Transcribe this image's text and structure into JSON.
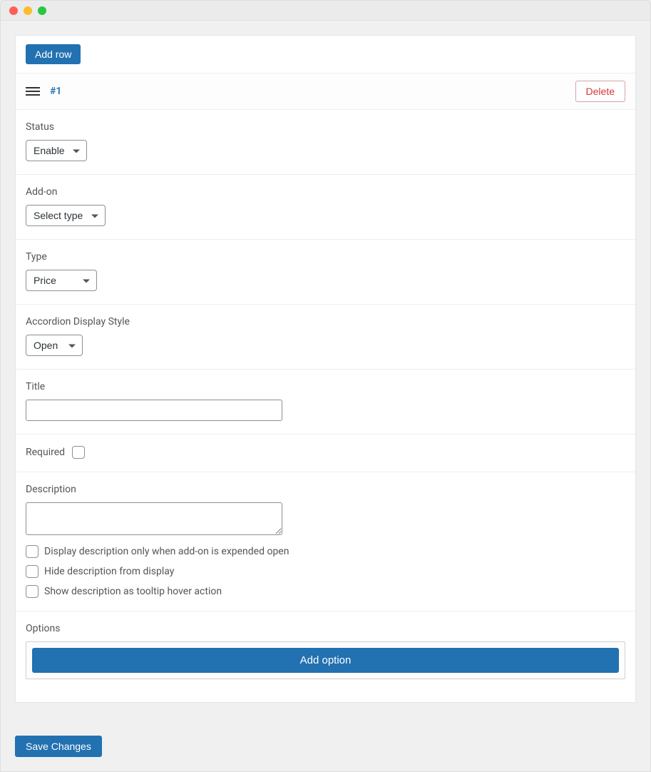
{
  "header": {
    "add_row_label": "Add row"
  },
  "row": {
    "label": "#1",
    "delete_label": "Delete"
  },
  "fields": {
    "status": {
      "label": "Status",
      "value": "Enable"
    },
    "addon": {
      "label": "Add-on",
      "value": "Select type"
    },
    "type": {
      "label": "Type",
      "value": "Price"
    },
    "accordion": {
      "label": "Accordion Display Style",
      "value": "Open"
    },
    "title": {
      "label": "Title",
      "value": ""
    },
    "required": {
      "label": "Required"
    },
    "description": {
      "label": "Description",
      "value": ""
    },
    "desc_opts": {
      "expanded": "Display description only when add-on is expended open",
      "hide": "Hide description from display",
      "tooltip": "Show description as tooltip hover action"
    },
    "options": {
      "label": "Options",
      "add_label": "Add option"
    }
  },
  "footer": {
    "save_label": "Save Changes"
  }
}
